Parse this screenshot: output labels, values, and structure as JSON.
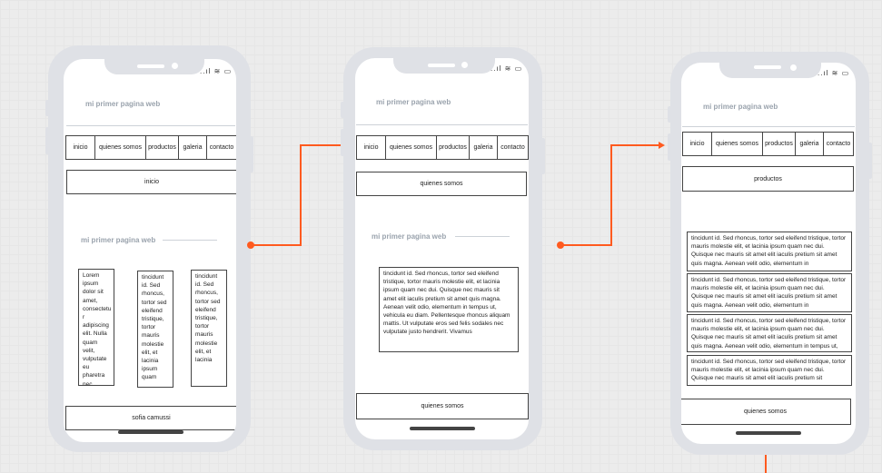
{
  "status_bar": "..ıl ≋ ▭",
  "phone1": {
    "title": "mi primer pagina web",
    "nav": [
      "inicio",
      "quienes somos",
      "productos",
      "galeria",
      "contacto"
    ],
    "page_box": "inicio",
    "section_title": "mi primer pagina web",
    "col1": "Lorem ipsum dolor sit amet, consectetu r adipiscing elit. Nulla quam velit, vulputate eu pharetra nec",
    "col2": "tincidunt id. Sed rhoncus, tortor sed eleifend tristique, tortor mauris molestie elit, et lacinia ipsum quam",
    "col3": "tincidunt id. Sed rhoncus, tortor sed eleifend tristique, tortor mauris molestie elit, et lacinia",
    "footer": "sofia camussi"
  },
  "phone2": {
    "title": "mi primer pagina web",
    "nav": [
      "inicio",
      "quienes somos",
      "productos",
      "galeria",
      "contacto"
    ],
    "page_box": "quienes somos",
    "section_title": "mi primer pagina web",
    "para": "tincidunt id. Sed rhoncus, tortor sed eleifend tristique, tortor mauris molestie elit, et lacinia ipsum quam nec dui. Quisque nec mauris sit amet elit iaculis pretium sit amet quis magna. Aenean velit odio, elementum in tempus ut, vehicula eu diam. Pellentesque rhoncus aliquam mattis. Ut vulputate eros sed felis sodales nec vulputate justo hendrerit. Vivamus",
    "footer": "quienes somos"
  },
  "phone3": {
    "title": "mi primer pagina web",
    "nav": [
      "inicio",
      "quienes somos",
      "productos",
      "galeria",
      "contacto"
    ],
    "page_box": "productos",
    "paras": [
      "tincidunt id. Sed rhoncus, tortor sed eleifend tristique, tortor mauris molestie elit, et lacinia ipsum quam nec dui. Quisque nec mauris sit amet elit iaculis pretium sit amet quis magna. Aenean velit odio, elementum in",
      "tincidunt id. Sed rhoncus, tortor sed eleifend tristique, tortor mauris molestie elit, et lacinia ipsum quam nec dui. Quisque nec mauris sit amet elit iaculis pretium sit amet quis magna. Aenean velit odio, elementum in",
      "tincidunt id. Sed rhoncus, tortor sed eleifend tristique, tortor mauris molestie elit, et lacinia ipsum quam nec dui. Quisque nec mauris sit amet elit iaculis pretium sit amet quis magna. Aenean velit odio, elementum in tempus ut,",
      "tincidunt id. Sed rhoncus, tortor sed eleifend tristique, tortor mauris molestie elit, et lacinia ipsum quam nec dui. Quisque nec mauris sit amet elit iaculis pretium sit"
    ],
    "footer": "quienes somos"
  },
  "colors": {
    "accent": "#ff5a1f",
    "phone_frame": "#dfe1e6",
    "title": "#9aa3ad"
  }
}
